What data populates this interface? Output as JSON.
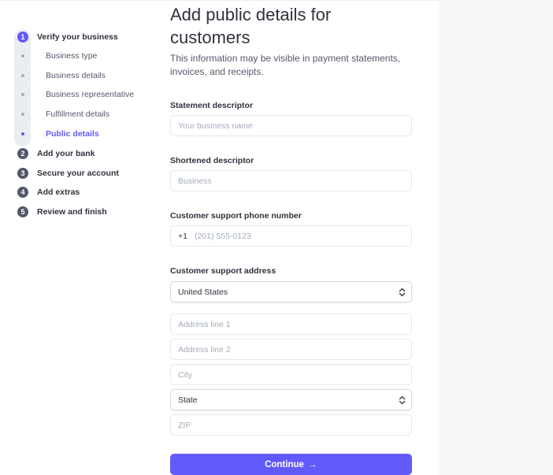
{
  "sidebar": {
    "steps": [
      {
        "number": "1",
        "label": "Verify your business",
        "active": true
      },
      {
        "number": "2",
        "label": "Add your bank"
      },
      {
        "number": "3",
        "label": "Secure your account"
      },
      {
        "number": "4",
        "label": "Add extras"
      },
      {
        "number": "5",
        "label": "Review and finish"
      }
    ],
    "substeps": [
      {
        "label": "Business type"
      },
      {
        "label": "Business details"
      },
      {
        "label": "Business representative"
      },
      {
        "label": "Fulfillment details"
      },
      {
        "label": "Public details",
        "active": true
      }
    ]
  },
  "main": {
    "title": "Add public details for customers",
    "subtitle": "This information may be visible in payment statements, invoices, and receipts.",
    "statement_descriptor": {
      "label": "Statement descriptor",
      "placeholder": "Your business name",
      "value": ""
    },
    "shortened_descriptor": {
      "label": "Shortened descriptor",
      "placeholder": "Business",
      "value": ""
    },
    "support_phone": {
      "label": "Customer support phone number",
      "prefix": "+1",
      "placeholder": "(201) 555-0123",
      "value": ""
    },
    "support_address": {
      "label": "Customer support address",
      "country": "United States",
      "address_line1_placeholder": "Address line 1",
      "address_line2_placeholder": "Address line 2",
      "city_placeholder": "City",
      "state": "State",
      "zip_placeholder": "ZIP"
    },
    "continue_label": "Continue",
    "continue_arrow": "→"
  },
  "colors": {
    "accent": "#625afa",
    "text": "#30313d",
    "muted_text": "#545969",
    "placeholder": "#a3acb9",
    "border": "#e3e8ee",
    "side_panel": "#f6f8fa"
  },
  "icons": {
    "select_chevron": "chevron-up-down-icon",
    "continue_arrow": "arrow-right-icon"
  }
}
